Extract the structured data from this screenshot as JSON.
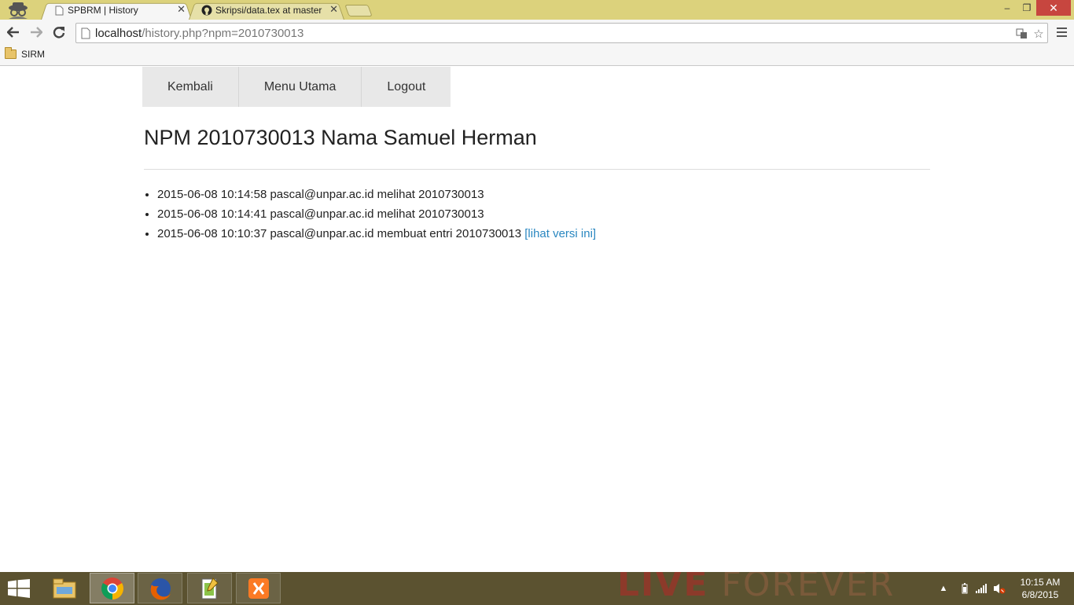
{
  "browser": {
    "tabs": [
      {
        "title": "SPBRM | History",
        "favicon": "page-icon",
        "active": true
      },
      {
        "title": "Skripsi/data.tex at master",
        "favicon": "github-icon",
        "active": false
      }
    ],
    "address": {
      "host": "localhost",
      "path": "/history.php?npm=2010730013"
    },
    "bookmarks": [
      {
        "label": "SIRM",
        "icon": "folder-icon"
      }
    ],
    "window_controls": {
      "minimize": "–",
      "restore": "❐",
      "close": "✕"
    }
  },
  "page": {
    "nav": [
      {
        "label": "Kembali"
      },
      {
        "label": "Menu Utama"
      },
      {
        "label": "Logout"
      }
    ],
    "heading": "NPM 2010730013 Nama Samuel Herman",
    "history": [
      {
        "text": "2015-06-08 10:14:58 pascal@unpar.ac.id melihat 2010730013",
        "link": ""
      },
      {
        "text": "2015-06-08 10:14:41 pascal@unpar.ac.id melihat 2010730013",
        "link": ""
      },
      {
        "text": "2015-06-08 10:10:37 pascal@unpar.ac.id membuat entri 2010730013 ",
        "link": "[lihat versi ini]"
      }
    ],
    "link_color": "#2a87c0"
  },
  "taskbar": {
    "apps": [
      "file-explorer-icon",
      "chrome-icon",
      "firefox-icon",
      "notepad-plus-plus-icon",
      "xampp-icon"
    ],
    "wallpaper_text": {
      "bold": "LIVE",
      "light": " FOREVER"
    },
    "clock": {
      "time": "10:15 AM",
      "date": "6/8/2015"
    }
  }
}
